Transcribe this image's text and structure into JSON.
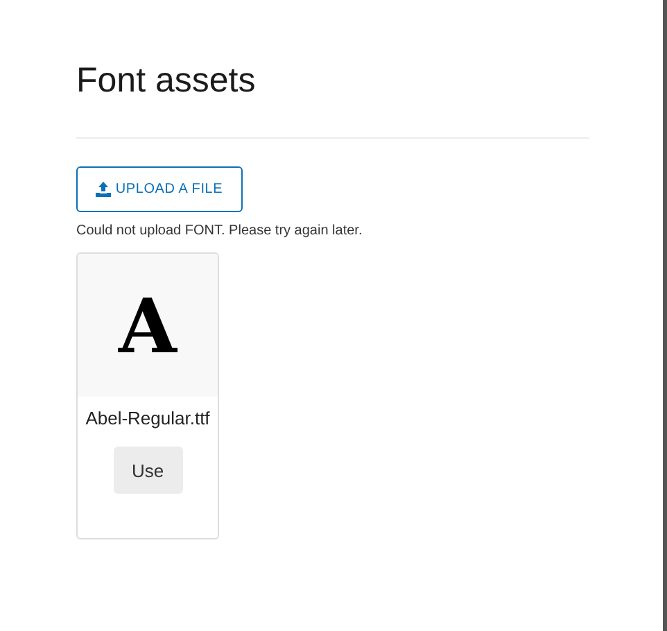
{
  "page": {
    "title": "Font assets"
  },
  "upload_button": {
    "label": "UPLOAD A FILE"
  },
  "error_message": "Could not upload FONT. Please try again later.",
  "assets": [
    {
      "preview": "A",
      "name": "Abel-Regular.ttf",
      "action": "Use"
    }
  ]
}
